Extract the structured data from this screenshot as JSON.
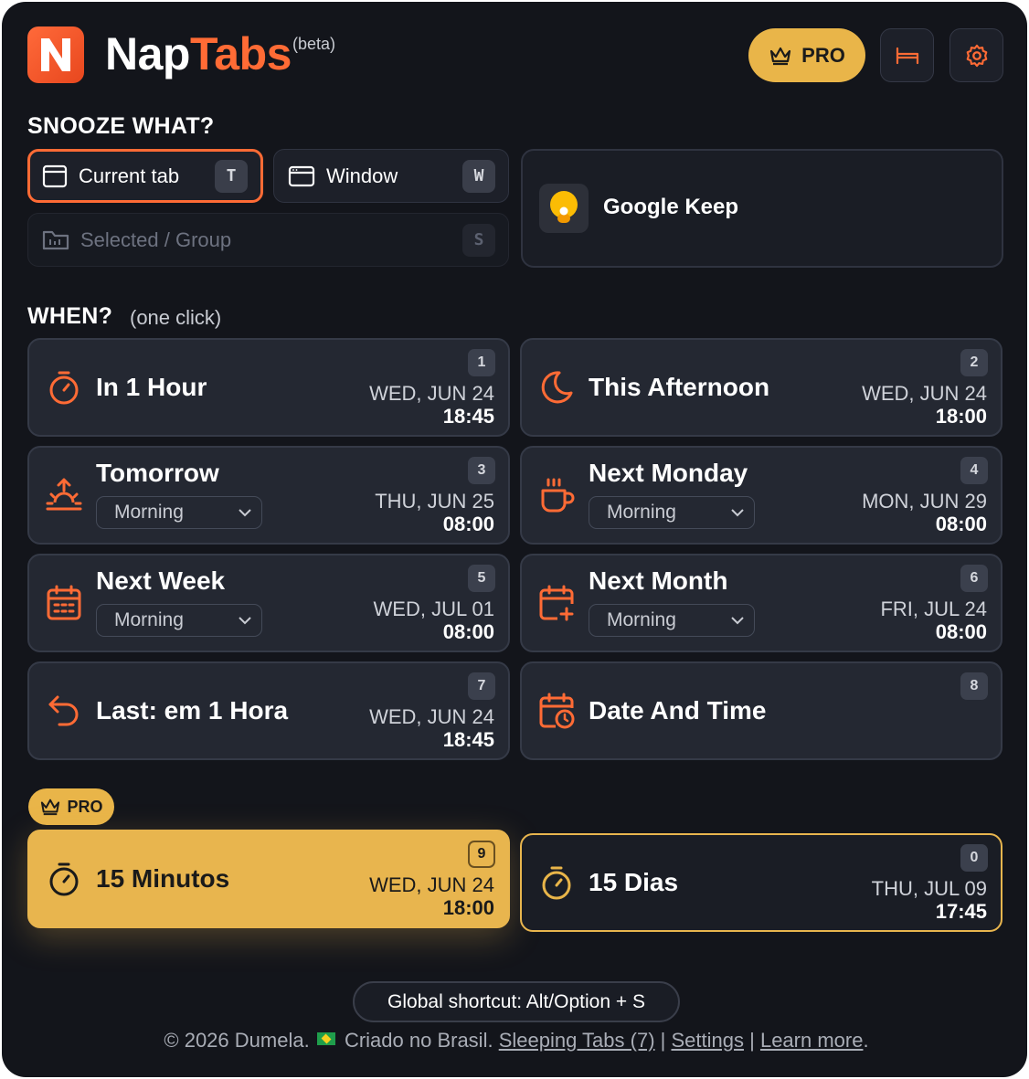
{
  "header": {
    "brand_part1": "Nap",
    "brand_part2": "Tabs",
    "beta": "(beta)",
    "pro_label": "PRO"
  },
  "snooze_what": {
    "title": "SNOOZE WHAT?",
    "options": [
      {
        "label": "Current tab",
        "key": "T",
        "active": true
      },
      {
        "label": "Window",
        "key": "W",
        "active": false
      },
      {
        "label": "Selected / Group",
        "key": "S",
        "disabled": true
      }
    ],
    "current_tab": {
      "title": "Google Keep"
    }
  },
  "when": {
    "title": "WHEN?",
    "hint": "(one click)",
    "options": [
      {
        "label": "In 1 Hour",
        "num": "1",
        "date": "WED, JUN 24",
        "time": "18:45",
        "icon": "timer-icon"
      },
      {
        "label": "This Afternoon",
        "num": "2",
        "date": "WED, JUN 24",
        "time": "18:00",
        "icon": "moon-icon"
      },
      {
        "label": "Tomorrow",
        "num": "3",
        "date": "THU, JUN 25",
        "time": "08:00",
        "select": "Morning",
        "icon": "sunrise-icon"
      },
      {
        "label": "Next Monday",
        "num": "4",
        "date": "MON, JUN 29",
        "time": "08:00",
        "select": "Morning",
        "icon": "coffee-icon"
      },
      {
        "label": "Next Week",
        "num": "5",
        "date": "WED, JUL 01",
        "time": "08:00",
        "select": "Morning",
        "icon": "calendar-icon"
      },
      {
        "label": "Next Month",
        "num": "6",
        "date": "FRI, JUL 24",
        "time": "08:00",
        "select": "Morning",
        "icon": "calendar-plus-icon"
      },
      {
        "label": "Last: em 1 Hora",
        "num": "7",
        "date": "WED, JUN 24",
        "time": "18:45",
        "icon": "undo-icon"
      },
      {
        "label": "Date And Time",
        "num": "8",
        "icon": "calendar-clock-icon"
      }
    ]
  },
  "pro": {
    "badge": "PRO",
    "options": [
      {
        "label": "15 Minutos",
        "num": "9",
        "date": "WED, JUN 24",
        "time": "18:00"
      },
      {
        "label": "15 Dias",
        "num": "0",
        "date": "THU, JUL 09",
        "time": "17:45"
      }
    ]
  },
  "footer": {
    "shortcut": "Global shortcut: Alt/Option + S",
    "copyright": "© 2026 Dumela.",
    "made_in": "Criado no Brasil.",
    "sleeping_tabs": "Sleeping Tabs (7)",
    "sep": "|",
    "settings": "Settings",
    "learn_more": "Learn more",
    "period": "."
  },
  "colors": {
    "accent": "#ff6b35",
    "gold": "#e9b549",
    "background": "#13151b",
    "card": "#242832"
  }
}
